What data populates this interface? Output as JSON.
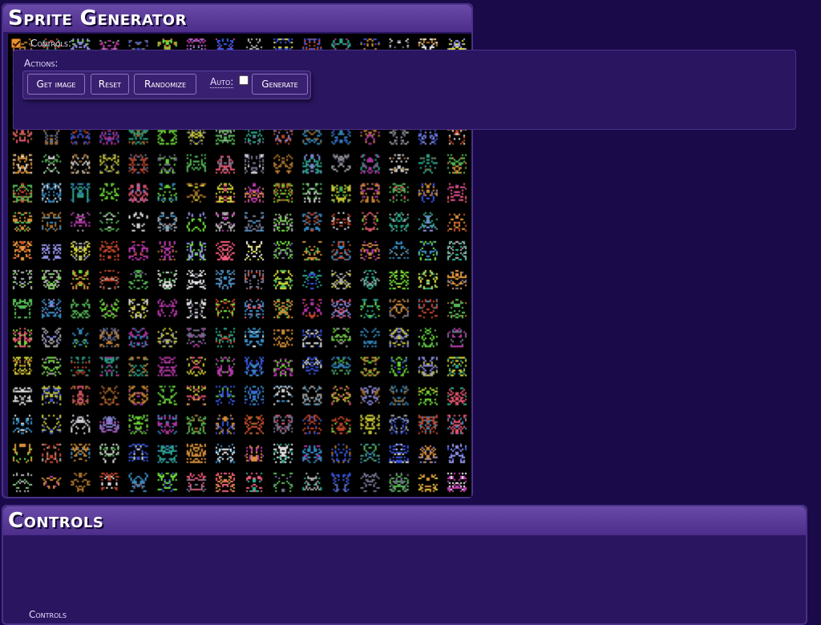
{
  "sprite_panel": {
    "title": "Sprite Generator"
  },
  "controls_panel": {
    "title": "Controls",
    "section_label": "Controls:",
    "section_expanded": true,
    "actions_label": "Actions:",
    "buttons": {
      "get_image": "Get image",
      "reset": "Reset",
      "randomize": "Randomize",
      "generate": "Generate"
    },
    "auto_label": "Auto:",
    "auto_checked": false,
    "next_section_label": "Controls"
  },
  "grid": {
    "columns": 16,
    "rows": 16
  },
  "colors": {
    "page_background": "#1a0a4a",
    "panel_background": "#2a1560",
    "title_bar": "#5a3a98",
    "canvas_background": "#000000",
    "checkbox_accent": "#e89030"
  }
}
